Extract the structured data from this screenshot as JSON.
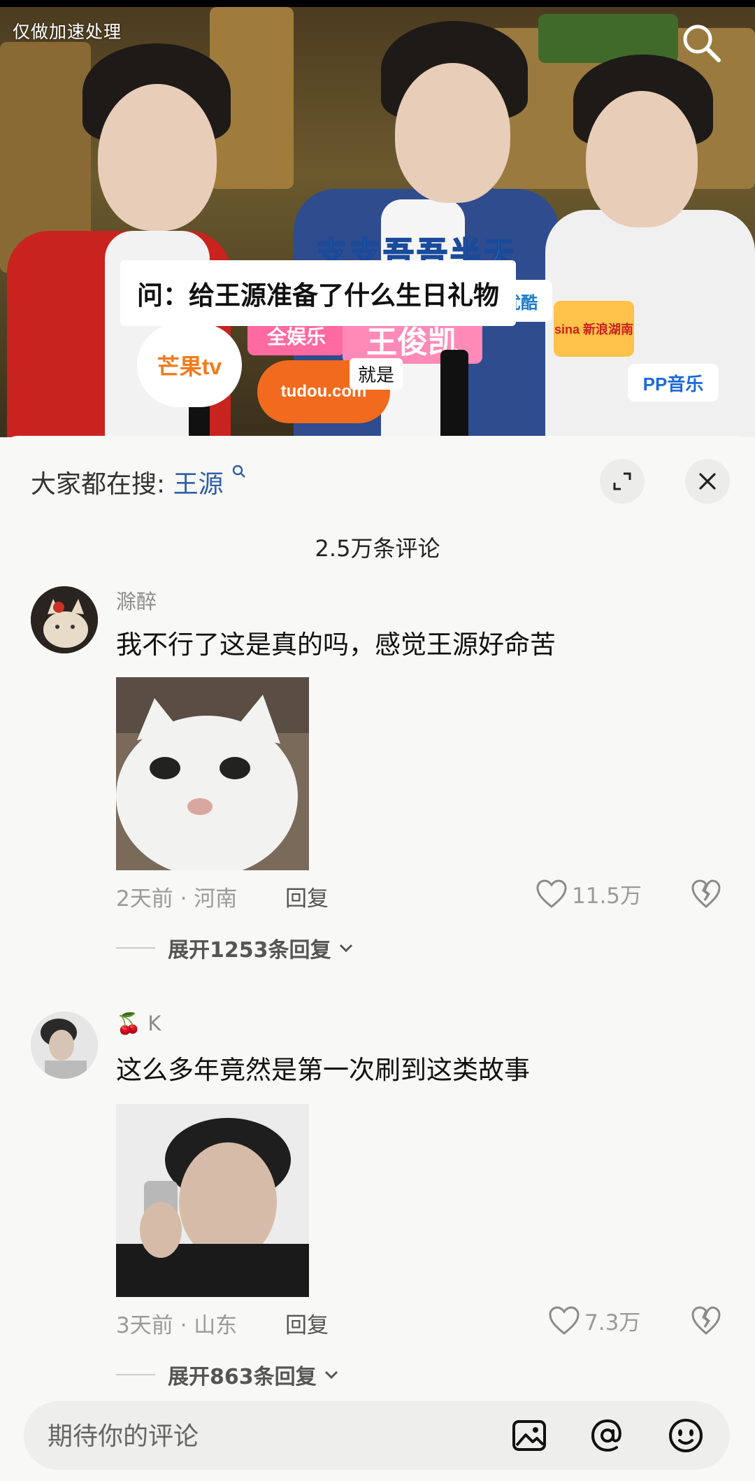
{
  "video": {
    "watermark": "仅做加速处理",
    "name_caption": "支支吾吾半天",
    "question_caption": "问：给王源准备了什么生日礼物",
    "sub_caption": "就是",
    "name_plate": "王俊凯",
    "mic_labels": {
      "mango": "芒果tv",
      "tudou": "tudou.com",
      "sina": "sina 新浪湖南",
      "pp": "PP音乐",
      "entertainment": "全娱乐",
      "youku": "优酷"
    },
    "search_icon": "search-icon"
  },
  "panel": {
    "trending_prefix": "大家都在搜:",
    "trending_keyword": "王源",
    "comment_count": "2.5万条评论",
    "expand_icon": "expand-icon",
    "close_icon": "close-icon"
  },
  "comments": [
    {
      "username": "滁醉",
      "text": "我不行了这是真的吗，感觉王源好命苦",
      "image": "cat-meme",
      "time_location": "2天前 · 河南",
      "reply_label": "回复",
      "likes": "11.5万",
      "expand_label": "展开1253条回复"
    },
    {
      "username": "K",
      "username_emoji": "🍒",
      "text": "这么多年竟然是第一次刷到这类故事",
      "image": "person-photo",
      "time_location": "3天前 · 山东",
      "reply_label": "回复",
      "likes": "7.3万",
      "expand_label": "展开863条回复"
    }
  ],
  "input_bar": {
    "placeholder": "期待你的评论",
    "icons": [
      "image-icon",
      "at-icon",
      "emoji-icon"
    ]
  },
  "colors": {
    "accent_blue": "#2f5fa8",
    "panel_bg": "#f8f8f6",
    "muted_text": "#9a9a9a"
  }
}
